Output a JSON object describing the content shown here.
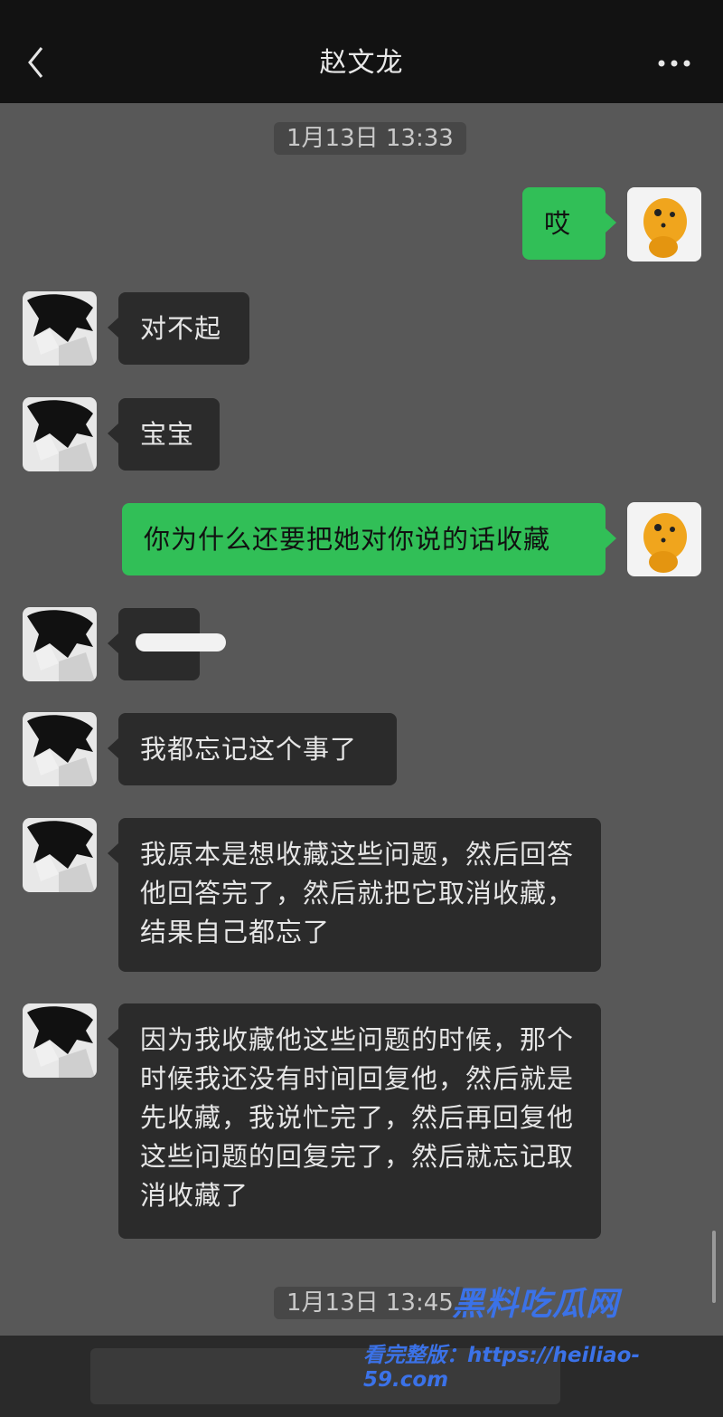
{
  "header": {
    "title": "赵文龙",
    "back_icon": "chevron-left-icon",
    "more_icon": "more-dots-icon"
  },
  "timestamps": [
    "1月13日 13:33",
    "1月13日 13:45"
  ],
  "messages": [
    {
      "side": "out",
      "text": "哎"
    },
    {
      "side": "in",
      "text": "对不起"
    },
    {
      "side": "in",
      "text": "宝宝"
    },
    {
      "side": "out",
      "text": "你为什么还要把她对你说的话收藏"
    },
    {
      "side": "in",
      "text": ""
    },
    {
      "side": "in",
      "text": "我都忘记这个事了"
    },
    {
      "side": "in",
      "text": "我原本是想收藏这些问题，然后回答他回答完了，然后就把它取消收藏，结果自己都忘了"
    },
    {
      "side": "in",
      "text": "因为我收藏他这些问题的时候，那个时候我还没有时间回复他，然后就是先收藏，我说忙完了，然后再回复他这些问题的回复完了，然后就忘记取消收藏了"
    }
  ],
  "watermark": {
    "logo": "黑料吃瓜网",
    "link": "看完整版：https://heiliao-59.com"
  },
  "colors": {
    "outgoing": "#31bf57",
    "incoming": "#2b2b2b",
    "background": "#585858"
  }
}
